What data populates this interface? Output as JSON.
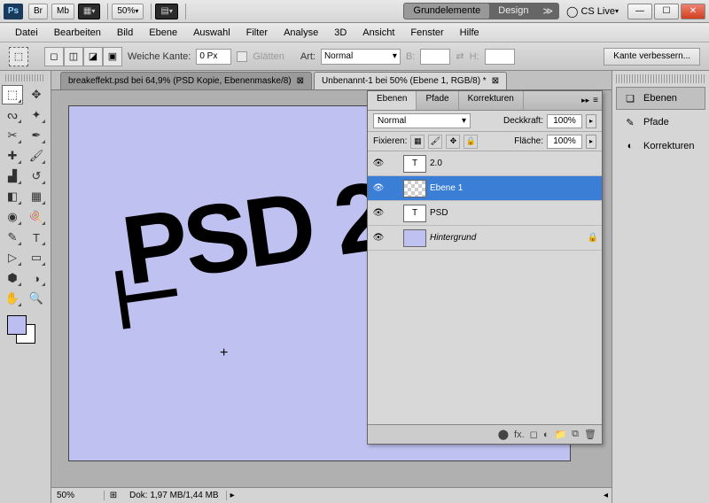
{
  "titlebar": {
    "zoom": "50%",
    "ws_tabs": [
      "Grundelemente",
      "Design"
    ],
    "cslive": "CS Live"
  },
  "menu": [
    "Datei",
    "Bearbeiten",
    "Bild",
    "Ebene",
    "Auswahl",
    "Filter",
    "Analyse",
    "3D",
    "Ansicht",
    "Fenster",
    "Hilfe"
  ],
  "options": {
    "feather_label": "Weiche Kante:",
    "feather_value": "0 Px",
    "antialias_label": "Glätten",
    "style_label": "Art:",
    "style_value": "Normal",
    "width_label": "B:",
    "height_label": "H:",
    "refine_label": "Kante verbessern..."
  },
  "doc_tabs": [
    "breakeffekt.psd bei 64,9% (PSD Kopie, Ebenenmaske/8)",
    "Unbenannt-1 bei 50% (Ebene 1, RGB/8) *"
  ],
  "canvas": {
    "text": "PSD 2"
  },
  "status": {
    "zoom": "50%",
    "doc": "Dok: 1,97 MB/1,44 MB"
  },
  "layers_panel": {
    "tabs": [
      "Ebenen",
      "Pfade",
      "Korrekturen"
    ],
    "blend": "Normal",
    "opacity_label": "Deckkraft:",
    "opacity_value": "100%",
    "lock_label": "Fixieren:",
    "fill_label": "Fläche:",
    "fill_value": "100%",
    "layers": [
      {
        "name": "2.0",
        "type": "T"
      },
      {
        "name": "Ebene 1",
        "type": "img",
        "selected": true
      },
      {
        "name": "PSD",
        "type": "T"
      },
      {
        "name": "Hintergrund",
        "type": "bg",
        "italic": true,
        "locked": true
      }
    ]
  },
  "dock": [
    "Ebenen",
    "Pfade",
    "Korrekturen"
  ]
}
